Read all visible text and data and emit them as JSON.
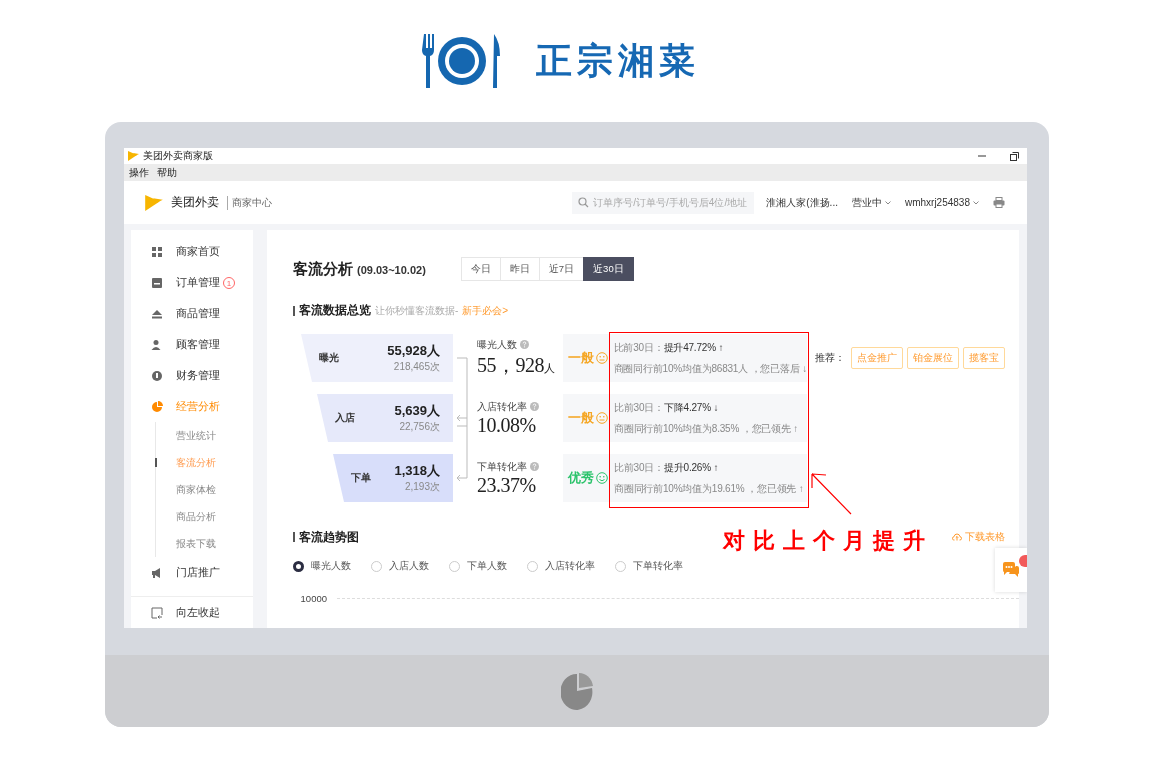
{
  "brand": {
    "title": "正宗湘菜"
  },
  "window": {
    "title": "美团外卖商家版",
    "menu": [
      "操作",
      "帮助"
    ]
  },
  "header": {
    "brand": "美团外卖",
    "subtitle": "商家中心",
    "search": {
      "placeholder": "订单序号/订单号/手机号后4位/地址"
    },
    "store": "淮湘人家(淮扬...",
    "status": "营业中",
    "user": "wmhxrj254838"
  },
  "sidebar": {
    "items": [
      {
        "label": "商家首页",
        "selected": false
      },
      {
        "label": "订单管理",
        "selected": false,
        "badge": "1"
      },
      {
        "label": "商品管理",
        "selected": false
      },
      {
        "label": "顾客管理",
        "selected": false
      },
      {
        "label": "财务管理",
        "selected": false
      },
      {
        "label": "经营分析",
        "selected": true,
        "children": [
          {
            "label": "营业统计",
            "selected": false
          },
          {
            "label": "客流分析",
            "selected": true
          },
          {
            "label": "商家体检",
            "selected": false
          },
          {
            "label": "商品分析",
            "selected": false
          },
          {
            "label": "报表下载",
            "selected": false
          }
        ]
      },
      {
        "label": "门店推广",
        "selected": false
      }
    ],
    "collapse": "向左收起"
  },
  "main": {
    "title": "客流分析",
    "range": "(09.03~10.02)",
    "tabs": [
      {
        "label": "今日",
        "selected": false
      },
      {
        "label": "昨日",
        "selected": false
      },
      {
        "label": "近7日",
        "selected": false
      },
      {
        "label": "近30日",
        "selected": true
      }
    ],
    "overview": {
      "title": "客流数据总览",
      "hint": "让你秒懂客流数据-",
      "link": "新手必会>"
    },
    "funnel": [
      {
        "label": "曝光",
        "count": "55,928人",
        "times": "218,465次"
      },
      {
        "label": "入店",
        "count": "5,639人",
        "times": "22,756次"
      },
      {
        "label": "下单",
        "count": "1,318人",
        "times": "2,193次"
      }
    ],
    "metrics": [
      {
        "label": "曝光人数",
        "value": "55，928",
        "unit": "人",
        "rating": "一般",
        "kind": "normal",
        "compare": "比前30日：",
        "change": "提升47.72% ↑",
        "peer": "商圈同行前10%均值为86831人 ，您已落后 ↓"
      },
      {
        "label": "入店转化率",
        "value": "10.08%",
        "rating": "一般",
        "kind": "normal",
        "compare": "比前30日：",
        "change": "下降4.27% ↓",
        "peer": "商圈同行前10%均值为8.35% ，您已领先 ↑"
      },
      {
        "label": "下单转化率",
        "value": "23.37%",
        "rating": "优秀",
        "kind": "good",
        "compare": "比前30日：",
        "change": "提升0.26% ↑",
        "peer": "商圈同行前10%均值为19.61% ，您已领先 ↑"
      }
    ],
    "recommend": {
      "label": "推荐：",
      "buttons": [
        "点金推广",
        "铂金展位",
        "揽客宝"
      ]
    },
    "trend": {
      "title": "客流趋势图",
      "download": "下载表格",
      "options": [
        {
          "label": "曝光人数",
          "selected": true
        },
        {
          "label": "入店人数",
          "selected": false
        },
        {
          "label": "下单人数",
          "selected": false
        },
        {
          "label": "入店转化率",
          "selected": false
        },
        {
          "label": "下单转化率",
          "selected": false
        }
      ],
      "axis_label": "10000"
    }
  },
  "annotation": {
    "text": "对比上个月提升"
  }
}
